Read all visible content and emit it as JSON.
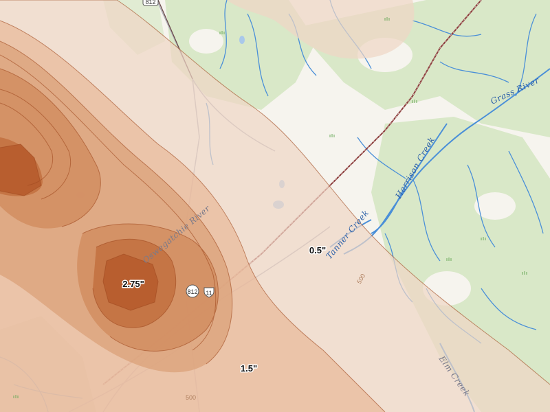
{
  "map": {
    "contour_labels": [
      "2.75\"",
      "1.5\"",
      "0.5\""
    ],
    "river_labels": [
      "Grass River",
      "Harrison Creek",
      "Tanner Creek",
      "Oswegatchie River",
      "Elm Creek"
    ],
    "route_shields": [
      "812",
      "812",
      "11"
    ],
    "elevation_labels": [
      "500",
      "500"
    ],
    "colors": {
      "land": "#f6f4ee",
      "forest": "#d9e8c8",
      "water": "#4a8fd8",
      "rail": "#8b3a3a",
      "road": "#b0b0b8",
      "precip_light": "#f0d6c4",
      "precip_mid": "#dba27a",
      "precip_dark": "#c2703f",
      "contour_line": "#a04a20"
    }
  }
}
